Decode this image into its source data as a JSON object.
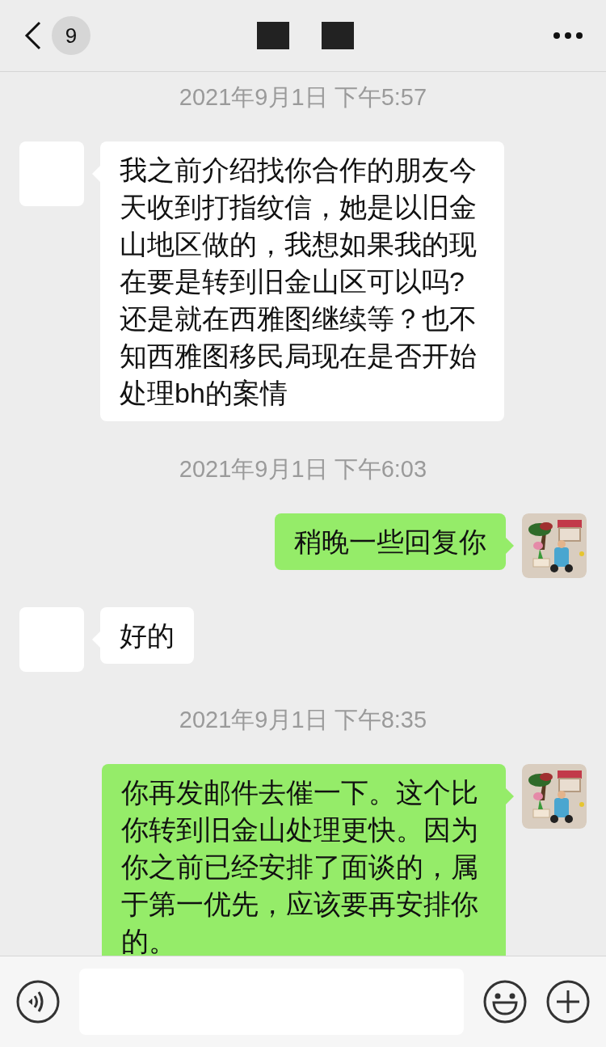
{
  "header": {
    "back_badge": "9"
  },
  "messages": [
    {
      "kind": "time",
      "text": "2021年9月1日 下午5:57"
    },
    {
      "kind": "received",
      "text": "我之前介绍找你合作的朋友今天收到打指纹信，她是以旧金山地区做的，我想如果我的现在要是转到旧金山区可以吗?还是就在西雅图继续等？也不知西雅图移民局现在是否开始处理bh的案情"
    },
    {
      "kind": "time",
      "text": "2021年9月1日 下午6:03"
    },
    {
      "kind": "sent",
      "text": "稍晚一些回复你"
    },
    {
      "kind": "received",
      "text": "好的"
    },
    {
      "kind": "time",
      "text": "2021年9月1日 下午8:35"
    },
    {
      "kind": "sent",
      "text": "你再发邮件去催一下。这个比你转到旧金山处理更快。因为你之前已经安排了面谈的，属于第一优先，应该要再安排你的。"
    }
  ]
}
